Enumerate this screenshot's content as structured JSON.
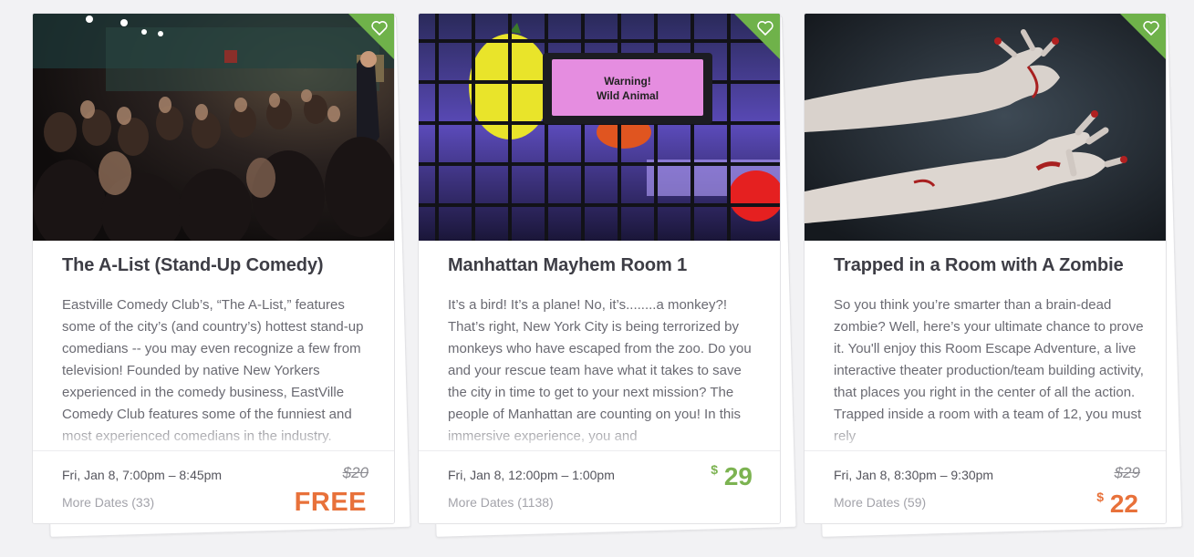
{
  "colors": {
    "accent_green": "#6fb24a",
    "price_orange": "#e8713a",
    "price_green": "#7cb351"
  },
  "cards": [
    {
      "image": "comedy-club-audience",
      "title": "The A-List (Stand-Up Comedy)",
      "description": "Eastville Comedy Club’s, “The A-List,” features some of the city’s (and country’s) hottest stand-up comedians -- you may even recognize a few from television! Founded by native New Yorkers experienced in the comedy business, EastVille Comedy Club features some of the funniest and most experienced comedians in the industry.",
      "date": "Fri, Jan 8, 7:00pm – 8:45pm",
      "more_dates": "More Dates (33)",
      "old_price": "$20",
      "price": "FREE"
    },
    {
      "image": "warning-wild-animal-cage",
      "sign_text": "Warning! Wild Animal",
      "title": "Manhattan Mayhem Room 1",
      "description": "It’s a bird! It’s a plane! No, it’s........a monkey?! That’s right, New York City is being terrorized by monkeys who have escaped from the zoo. Do you and your rescue team have what it takes to save the city in time to get to your next mission? The people of Manhattan are counting on you! In this immersive experience, you and",
      "date": "Fri, Jan 8, 12:00pm – 1:00pm",
      "more_dates": "More Dates (1138)",
      "currency": "$",
      "price": "29"
    },
    {
      "image": "zombie-hands",
      "title": "Trapped in a Room with A Zombie",
      "description": "So you think you’re smarter than a brain-dead zombie? Well, here’s your ultimate chance to prove it. You'll enjoy this Room Escape Adventure, a live interactive theater production/team building activity, that places you right in the center of all the action. Trapped inside a room with a team of 12, you must rely",
      "date": "Fri, Jan 8, 8:30pm – 9:30pm",
      "more_dates": "More Dates (59)",
      "old_price": "$29",
      "currency": "$",
      "price": "22"
    }
  ]
}
